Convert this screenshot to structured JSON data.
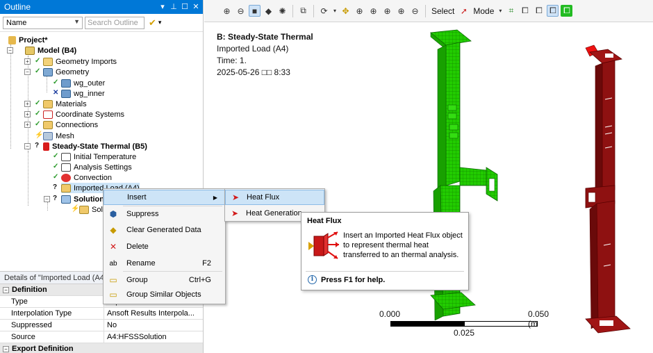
{
  "outline": {
    "title": "Outline",
    "title_icons": [
      "pin-icon",
      "dock-icon",
      "close-icon"
    ],
    "filter_combo": "Name",
    "search_placeholder": "Search Outline",
    "tree": [
      {
        "label": "Project*"
      },
      {
        "label": "Model (B4)"
      },
      {
        "label": "Geometry Imports"
      },
      {
        "label": "Geometry"
      },
      {
        "label": "wg_outer"
      },
      {
        "label": "wg_inner"
      },
      {
        "label": "Materials"
      },
      {
        "label": "Coordinate Systems"
      },
      {
        "label": "Connections"
      },
      {
        "label": "Mesh"
      },
      {
        "label": "Steady-State Thermal (B5)"
      },
      {
        "label": "Initial Temperature"
      },
      {
        "label": "Analysis Settings"
      },
      {
        "label": "Convection"
      },
      {
        "label": "Imported Load (A4)"
      },
      {
        "label": "Solution (B6)"
      },
      {
        "label": "Solution Information"
      }
    ]
  },
  "details": {
    "title": "Details of \"Imported Load (A4)\"",
    "group_definition": "Definition",
    "rows": [
      {
        "key": "Type",
        "value": "Imported Data"
      },
      {
        "key": "Interpolation Type",
        "value": "Ansoft Results Interpola..."
      },
      {
        "key": "Suppressed",
        "value": "No"
      },
      {
        "key": "Source",
        "value": "A4:HFSSSolution"
      }
    ],
    "group_export": "Export Definition"
  },
  "toolbar": {
    "select_label": "Select",
    "mode_label": "Mode"
  },
  "viewport": {
    "title": "B: Steady-State Thermal",
    "subtitle": "Imported Load (A4)",
    "time": "Time: 1.",
    "date": "2025-05-26 □□ 8:33",
    "scale_left": "0.000",
    "scale_right": "0.050 (m",
    "scale_mid": "0.025",
    "colors": {
      "green_model": "#22cc00",
      "red_model": "#8e1111"
    }
  },
  "context_menu": {
    "items": [
      {
        "label": "Insert",
        "shortcut": "",
        "icon": "insert-icon"
      },
      {
        "label": "Suppress",
        "shortcut": "",
        "icon": "suppress-icon"
      },
      {
        "label": "Clear Generated Data",
        "shortcut": "",
        "icon": "clear-data-icon"
      },
      {
        "label": "Delete",
        "shortcut": "",
        "icon": "delete-icon"
      },
      {
        "label": "Rename",
        "shortcut": "F2",
        "icon": "rename-icon"
      },
      {
        "label": "Group",
        "shortcut": "Ctrl+G",
        "icon": "group-icon"
      },
      {
        "label": "Group Similar Objects",
        "shortcut": "",
        "icon": "group-similar-icon"
      }
    ]
  },
  "submenu": {
    "items": [
      {
        "label": "Heat Flux",
        "icon": "heat-flux-icon"
      },
      {
        "label": "Heat Generation",
        "icon": "heat-generation-icon"
      }
    ]
  },
  "tooltip": {
    "title": "Heat Flux",
    "description": "Insert an Imported Heat Flux object to represent thermal heat transferred to an thermal analysis.",
    "help": "Press F1 for help."
  }
}
